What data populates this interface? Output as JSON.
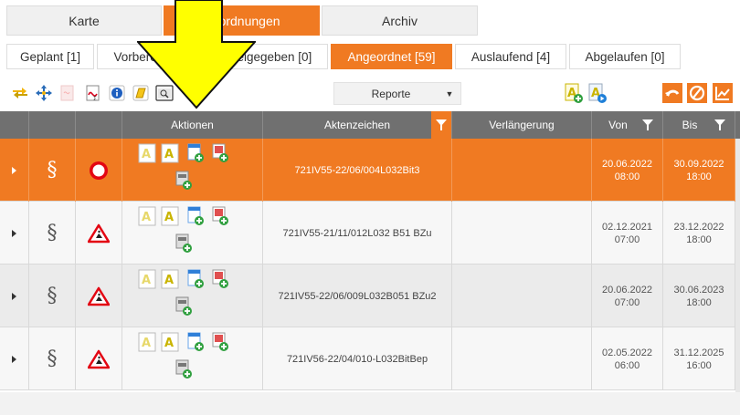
{
  "top_tabs": [
    {
      "label": "Karte",
      "active": false
    },
    {
      "label": "Anordnungen",
      "active": true
    },
    {
      "label": "Archiv",
      "active": false
    }
  ],
  "sub_tabs": [
    {
      "label": "Geplant [1]",
      "active": false
    },
    {
      "label": "Vorbereitet [0]",
      "active": false
    },
    {
      "label": "Freigegeben [0]",
      "active": false
    },
    {
      "label": "Angeordnet [59]",
      "active": true
    },
    {
      "label": "Auslaufend [4]",
      "active": false
    },
    {
      "label": "Abgelaufen [0]",
      "active": false
    }
  ],
  "toolbar": {
    "report_select": "Reporte",
    "icons": [
      "transfer-icon",
      "move-icon",
      "pdf-disabled-icon",
      "pdf-export-icon",
      "info-icon",
      "notes-icon",
      "preview-icon",
      "add-text-icon",
      "play-text-icon",
      "undo-icon",
      "cancel-icon",
      "chart-icon"
    ]
  },
  "grid": {
    "columns": [
      "",
      "",
      "",
      "Aktionen",
      "Aktenzeichen",
      "Verlängerung",
      "Von",
      "Bis"
    ],
    "rows": [
      {
        "selected": true,
        "status": "stop-sign",
        "aktenzeichen": "721IV55-22/06/004L032Bit3",
        "verlaengerung": "",
        "von_date": "20.06.2022",
        "von_time": "08:00",
        "bis_date": "30.09.2022",
        "bis_time": "18:00"
      },
      {
        "selected": false,
        "status": "roadworks-sign",
        "aktenzeichen": "721IV55-21/11/012L032 B51 BZu",
        "verlaengerung": "",
        "von_date": "02.12.2021",
        "von_time": "07:00",
        "bis_date": "23.12.2022",
        "bis_time": "18:00"
      },
      {
        "selected": false,
        "status": "roadworks-sign",
        "aktenzeichen": "721IV55-22/06/009L032B051 BZu2",
        "verlaengerung": "",
        "von_date": "20.06.2022",
        "von_time": "07:00",
        "bis_date": "30.06.2023",
        "bis_time": "18:00"
      },
      {
        "selected": false,
        "status": "roadworks-sign",
        "aktenzeichen": "721IV56-22/04/010-L032BitBep",
        "verlaengerung": "",
        "von_date": "02.05.2022",
        "von_time": "06:00",
        "bis_date": "31.12.2025",
        "bis_time": "16:00"
      }
    ],
    "para_symbol": "§"
  },
  "colors": {
    "accent": "#f07a22",
    "header": "#707070",
    "arrow": "#ffff00"
  }
}
